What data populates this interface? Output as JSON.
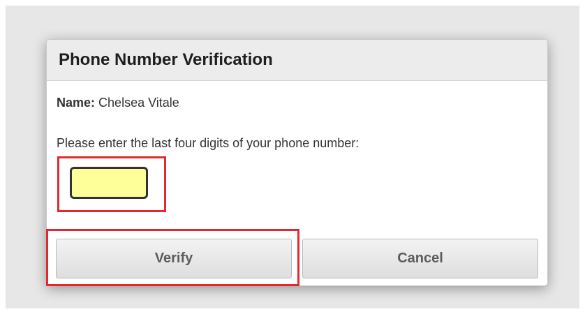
{
  "dialog": {
    "title": "Phone Number Verification",
    "name_label": "Name:",
    "name_value": "Chelsea Vitale",
    "prompt": "Please enter the last four digits of your phone number:",
    "input_value": "",
    "verify_label": "Verify",
    "cancel_label": "Cancel"
  },
  "colors": {
    "input_background": "#ffff99",
    "highlight_outline": "#e5282e",
    "header_background": "#ececec"
  }
}
